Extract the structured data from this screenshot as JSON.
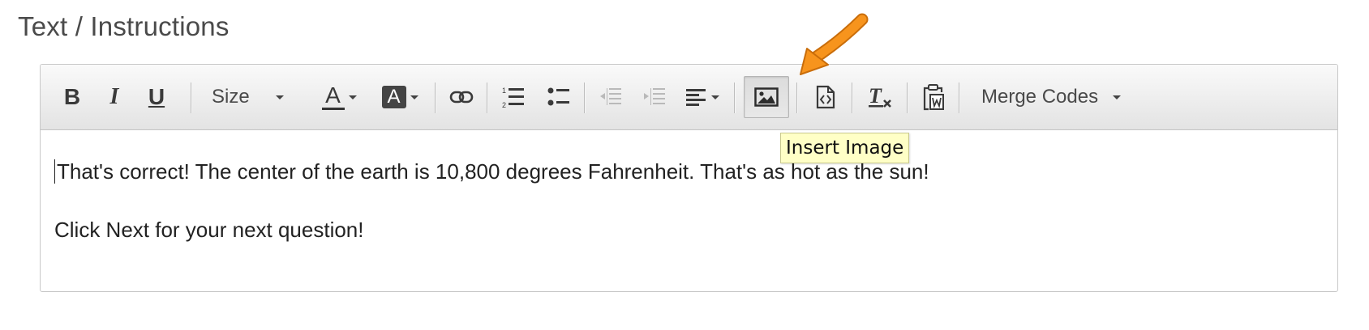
{
  "section": {
    "title": "Text / Instructions"
  },
  "toolbar": {
    "bold": {
      "label": "B",
      "icon": "bold-icon"
    },
    "italic": {
      "label": "I",
      "icon": "italic-icon"
    },
    "underline": {
      "label": "U",
      "icon": "underline-icon"
    },
    "size_label": "Size",
    "text_color_label": "A",
    "background_color_label": "A",
    "merge_codes_label": "Merge Codes",
    "icons": [
      "link-icon",
      "numbered-list-icon",
      "bullet-list-icon",
      "outdent-icon",
      "indent-icon",
      "align-icon",
      "image-icon",
      "source-icon",
      "clear-formatting-icon",
      "paste-word-icon"
    ]
  },
  "tooltip": {
    "text": "Insert Image"
  },
  "content": {
    "paragraph1": "That's correct! The center of the earth is 10,800 degrees Fahrenheit. That's as hot as the sun!",
    "paragraph2": "Click Next for your next question!"
  },
  "colors": {
    "arrow": "#f7941d",
    "tooltip_bg": "#ffffc6",
    "toolbar_bg": "#e8e8e8"
  }
}
